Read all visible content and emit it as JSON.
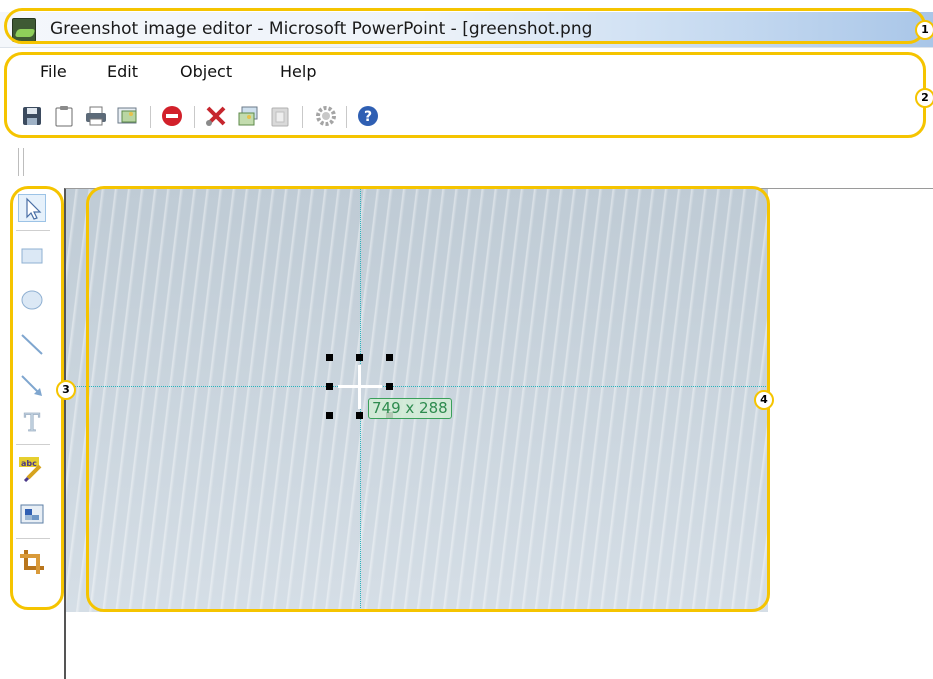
{
  "window": {
    "title": "Greenshot image editor - Microsoft PowerPoint - [greenshot.png",
    "icon": "greenshot-app-icon"
  },
  "menubar": {
    "items": [
      "File",
      "Edit",
      "Object",
      "Help"
    ]
  },
  "toolbar": {
    "buttons": [
      {
        "name": "save-icon"
      },
      {
        "name": "clipboard-icon"
      },
      {
        "name": "print-icon"
      },
      {
        "name": "export-image-icon"
      },
      {
        "name": "close-red-circle-icon"
      },
      {
        "name": "delete-cut-icon"
      },
      {
        "name": "copy-image-icon"
      },
      {
        "name": "paste-icon"
      },
      {
        "name": "settings-gear-icon"
      },
      {
        "name": "help-icon"
      }
    ]
  },
  "tools": [
    {
      "name": "select-pointer-tool-icon"
    },
    {
      "name": "rectangle-tool-icon"
    },
    {
      "name": "ellipse-tool-icon"
    },
    {
      "name": "line-tool-icon"
    },
    {
      "name": "arrow-tool-icon"
    },
    {
      "name": "text-tool-icon"
    },
    {
      "name": "highlight-abc-tool-icon"
    },
    {
      "name": "obfuscate-tool-icon"
    },
    {
      "name": "crop-tool-icon"
    }
  ],
  "canvas": {
    "selection_size_label": "749 x 288"
  },
  "callouts": [
    "1",
    "2",
    "3",
    "4"
  ],
  "colors": {
    "callout": "#f5c400",
    "guide": "#2ab3bd",
    "size_label": "#2e8b4f"
  }
}
